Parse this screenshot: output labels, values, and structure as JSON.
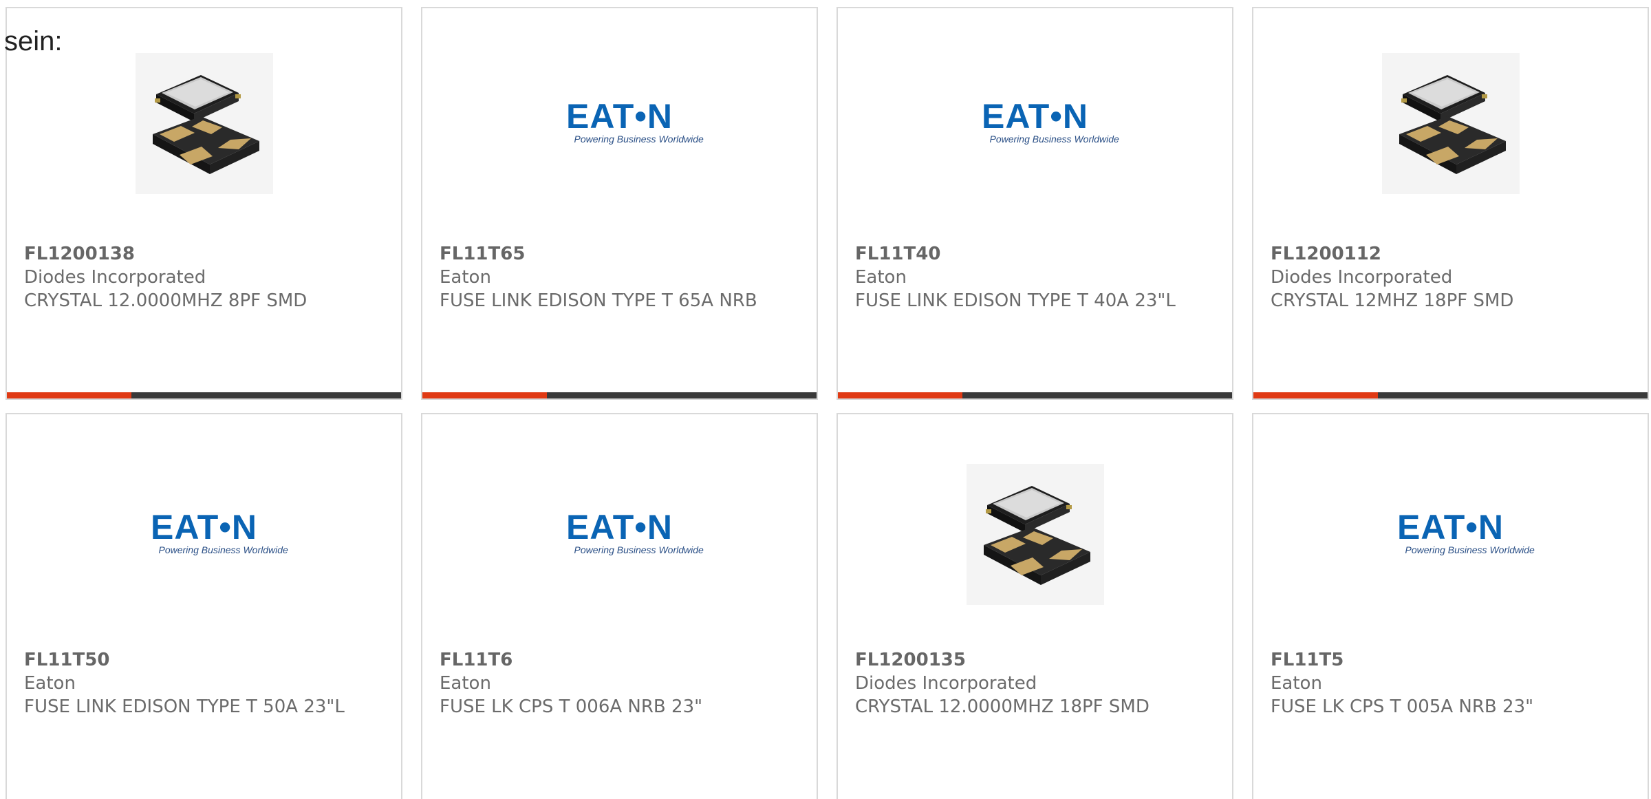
{
  "intro_text": "sein:",
  "colors": {
    "card_border": "#d9d9d9",
    "bar_dark": "#3a3a3a",
    "bar_accent": "#e03a14",
    "eaton_blue": "#0a64b4",
    "text_gray": "#6b6b6b"
  },
  "logo": {
    "eaton_word": "EAT•N",
    "eaton_tagline": "Powering Business Worldwide"
  },
  "products": [
    {
      "part_number": "FL1200138",
      "manufacturer": "Diodes Incorporated",
      "description": "CRYSTAL 12.0000MHZ 8PF SMD",
      "image": "crystal-smd-image"
    },
    {
      "part_number": "FL11T65",
      "manufacturer": "Eaton",
      "description": "FUSE LINK EDISON TYPE T 65A NRB",
      "image": "eaton-logo"
    },
    {
      "part_number": "FL11T40",
      "manufacturer": "Eaton",
      "description": "FUSE LINK EDISON TYPE T 40A 23\"L",
      "image": "eaton-logo"
    },
    {
      "part_number": "FL1200112",
      "manufacturer": "Diodes Incorporated",
      "description": "CRYSTAL 12MHZ 18PF SMD",
      "image": "crystal-smd-image"
    },
    {
      "part_number": "FL11T50",
      "manufacturer": "Eaton",
      "description": "FUSE LINK EDISON TYPE T 50A 23\"L",
      "image": "eaton-logo"
    },
    {
      "part_number": "FL11T6",
      "manufacturer": "Eaton",
      "description": "FUSE LK CPS T 006A NRB 23\"",
      "image": "eaton-logo"
    },
    {
      "part_number": "FL1200135",
      "manufacturer": "Diodes Incorporated",
      "description": "CRYSTAL 12.0000MHZ 18PF SMD",
      "image": "crystal-smd-image"
    },
    {
      "part_number": "FL11T5",
      "manufacturer": "Eaton",
      "description": "FUSE LK CPS T 005A NRB 23\"",
      "image": "eaton-logo"
    }
  ]
}
